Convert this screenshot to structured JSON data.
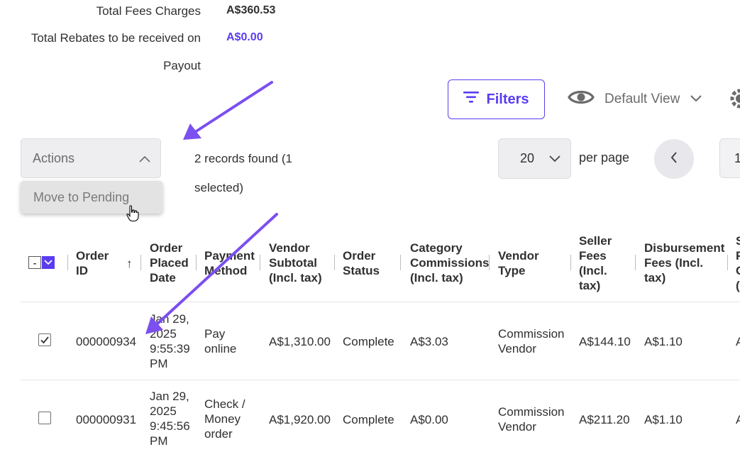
{
  "summary": {
    "fees_label": "Total Fees Charges",
    "fees_value": "A$360.53",
    "rebates_label_line1": "Total Rebates to be received on",
    "rebates_label_line2": "Payout",
    "rebates_value": "A$0.00"
  },
  "toolbar": {
    "filters_label": "Filters",
    "view_label": "Default View"
  },
  "actions": {
    "label": "Actions",
    "menu_item": "Move to Pending"
  },
  "records_text_line1": "2 records found (1",
  "records_text_line2": "selected)",
  "pagination": {
    "per_page_value": "20",
    "per_page_label": "per page",
    "current_page": "1"
  },
  "columns": {
    "order_id": [
      "Order",
      "ID"
    ],
    "sort_indicator": "↑",
    "placed_date": [
      "Order",
      "Placed",
      "Date"
    ],
    "payment_method": [
      "Payment",
      "Method"
    ],
    "vendor_subtotal": [
      "Vendor",
      "Subtotal",
      "(Incl. tax)"
    ],
    "order_status": [
      "Order",
      "Status"
    ],
    "category_commissions": [
      "Category",
      "Commissions",
      "(Incl. tax)"
    ],
    "vendor_type": [
      "Vendor",
      "Type"
    ],
    "seller_fees": [
      "Seller",
      "Fees",
      "(Incl.",
      "tax)"
    ],
    "disbursement_fees": [
      "Disbursement",
      "Fees (Incl.",
      "tax)"
    ],
    "cut_off": [
      "S",
      "F",
      "C",
      "("
    ]
  },
  "rows": [
    {
      "checked": true,
      "order_id": "000000934",
      "date": [
        "Jan 29,",
        "2025",
        "9:55:39",
        "PM"
      ],
      "payment": [
        "Pay",
        "online"
      ],
      "subtotal": "A$1,310.00",
      "status": "Complete",
      "commissions": "A$3.03",
      "vendor_type": [
        "Commission",
        "Vendor"
      ],
      "seller_fees": "A$144.10",
      "disbursement_fees": "A$1.10",
      "cut_off": "A"
    },
    {
      "checked": false,
      "order_id": "000000931",
      "date": [
        "Jan 29,",
        "2025",
        "9:45:56",
        "PM"
      ],
      "payment": [
        "Check /",
        "Money",
        "order"
      ],
      "subtotal": "A$1,920.00",
      "status": "Complete",
      "commissions": "A$0.00",
      "vendor_type": [
        "Commission",
        "Vendor"
      ],
      "seller_fees": "A$211.20",
      "disbursement_fees": "A$1.10",
      "cut_off": "A"
    }
  ],
  "colors": {
    "accent": "#5b3cf0",
    "annotation_arrow": "#7b4ff0"
  },
  "icons": {
    "filters": "filter-icon",
    "view": "eye-icon",
    "settings": "gear-icon",
    "cursor": "hand-pointer-icon"
  }
}
